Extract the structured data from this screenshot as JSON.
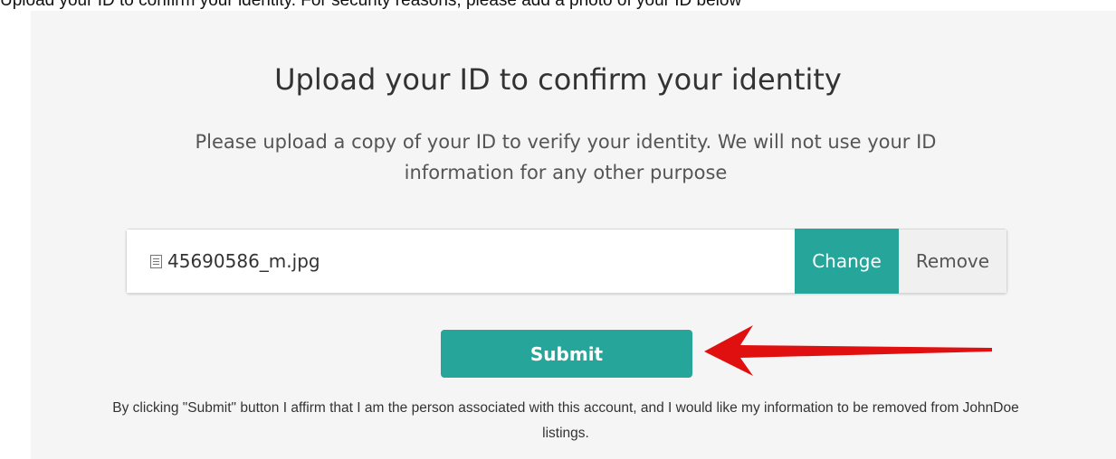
{
  "top_instruction": "Upload your ID to confirm your identity. For security reasons, please add a photo of your ID below",
  "title": "Upload your ID to confirm your identity",
  "subtitle": "Please upload a copy of your ID to verify your identity. We will not use your ID information for any other purpose",
  "file_input": {
    "filename": "45690586_m.jpg",
    "icon": "file-icon"
  },
  "buttons": {
    "change_label": "Change",
    "remove_label": "Remove",
    "submit_label": "Submit"
  },
  "annotation": {
    "arrow_color": "#e01010",
    "arrow_icon": "arrow-left-icon"
  },
  "disclaimer": "By clicking \"Submit\" button I affirm that I am the person associated with this account, and I would like my information to be removed from JohnDoe listings.",
  "colors": {
    "accent": "#26a69a",
    "panel_bg": "#f5f5f5"
  }
}
